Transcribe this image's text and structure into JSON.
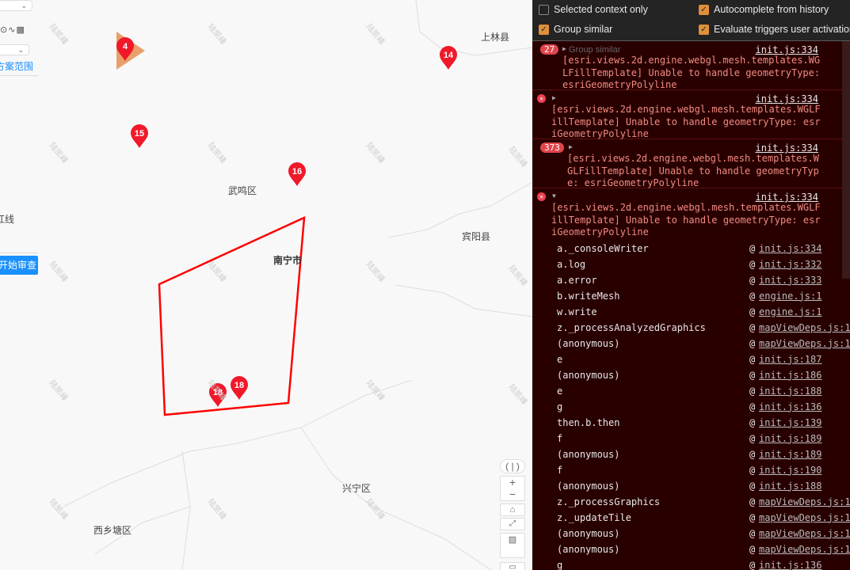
{
  "sidebar": {
    "scope_link": "方案范围",
    "redline_label": "红线",
    "start_review_button": "开始审查",
    "tool_icons": [
      "circle-icon",
      "polyline-icon",
      "hatch-polygon-icon"
    ]
  },
  "map": {
    "labels": {
      "shanglin": "上林县",
      "wuming": "武鸣区",
      "binyang": "宾阳县",
      "nanning": "南宁市",
      "xingning": "兴宁区",
      "xixiangtang": "西乡塘区"
    },
    "watermark": "陆凯峰",
    "markers": [
      "4",
      "14",
      "15",
      "16",
      "18",
      "18"
    ],
    "colors": {
      "marker": "#f0192a",
      "polygon": "#ff0000",
      "triangle": "#e8a06a"
    },
    "controls": [
      "compass-icon",
      "zoom-in-icon",
      "zoom-out-icon",
      "home-icon",
      "fullscreen-icon",
      "basemap-icon",
      "legend-icon"
    ]
  },
  "devtools": {
    "options": {
      "selected_context_only": {
        "label": "Selected context only",
        "checked": false
      },
      "autocomplete": {
        "label": "Autocomplete from history",
        "checked": true
      },
      "group_similar": {
        "label": "Group similar",
        "checked": true
      },
      "evaluate_triggers": {
        "label": "Evaluate triggers user activation",
        "checked": true
      }
    },
    "tooltip": "Group similar",
    "entries": [
      {
        "count": "27",
        "source": "init.js:334",
        "message": "[esri.views.2d.engine.webgl.mesh.templates.WGLFillTemplate] Unable to handle geometryType: esriGeometryPolyline"
      },
      {
        "count": "",
        "source": "init.js:334",
        "message": "[esri.views.2d.engine.webgl.mesh.templates.WGLFillTemplate] Unable to handle geometryType: esriGeometryPolyline"
      },
      {
        "count": "373",
        "source": "init.js:334",
        "message": "[esri.views.2d.engine.webgl.mesh.templates.WGLFillTemplate] Unable to handle geometryType: esriGeometryPolyline"
      },
      {
        "count": "",
        "source": "init.js:334",
        "message": "[esri.views.2d.engine.webgl.mesh.templates.WGLFillTemplate] Unable to handle geometryType: esriGeometryPolyline"
      }
    ],
    "stack": [
      {
        "fn": "a._consoleWriter",
        "loc": "init.js:334"
      },
      {
        "fn": "a.log",
        "loc": "init.js:332"
      },
      {
        "fn": "a.error",
        "loc": "init.js:333"
      },
      {
        "fn": "b.writeMesh",
        "loc": "engine.js:1"
      },
      {
        "fn": "w.write",
        "loc": "engine.js:1"
      },
      {
        "fn": "z._processAnalyzedGraphics",
        "loc": "mapViewDeps.js:1"
      },
      {
        "fn": "(anonymous)",
        "loc": "mapViewDeps.js:1"
      },
      {
        "fn": "e",
        "loc": "init.js:187"
      },
      {
        "fn": "(anonymous)",
        "loc": "init.js:186"
      },
      {
        "fn": "e",
        "loc": "init.js:188"
      },
      {
        "fn": "g",
        "loc": "init.js:136"
      },
      {
        "fn": "then.b.then",
        "loc": "init.js:139"
      },
      {
        "fn": "f",
        "loc": "init.js:189"
      },
      {
        "fn": "(anonymous)",
        "loc": "init.js:189"
      },
      {
        "fn": "f",
        "loc": "init.js:190"
      },
      {
        "fn": "(anonymous)",
        "loc": "init.js:188"
      },
      {
        "fn": "z._processGraphics",
        "loc": "mapViewDeps.js:1"
      },
      {
        "fn": "z._updateTile",
        "loc": "mapViewDeps.js:1"
      },
      {
        "fn": "(anonymous)",
        "loc": "mapViewDeps.js:1"
      },
      {
        "fn": "(anonymous)",
        "loc": "mapViewDeps.js:1"
      },
      {
        "fn": "g",
        "loc": "init.js:136"
      }
    ]
  }
}
